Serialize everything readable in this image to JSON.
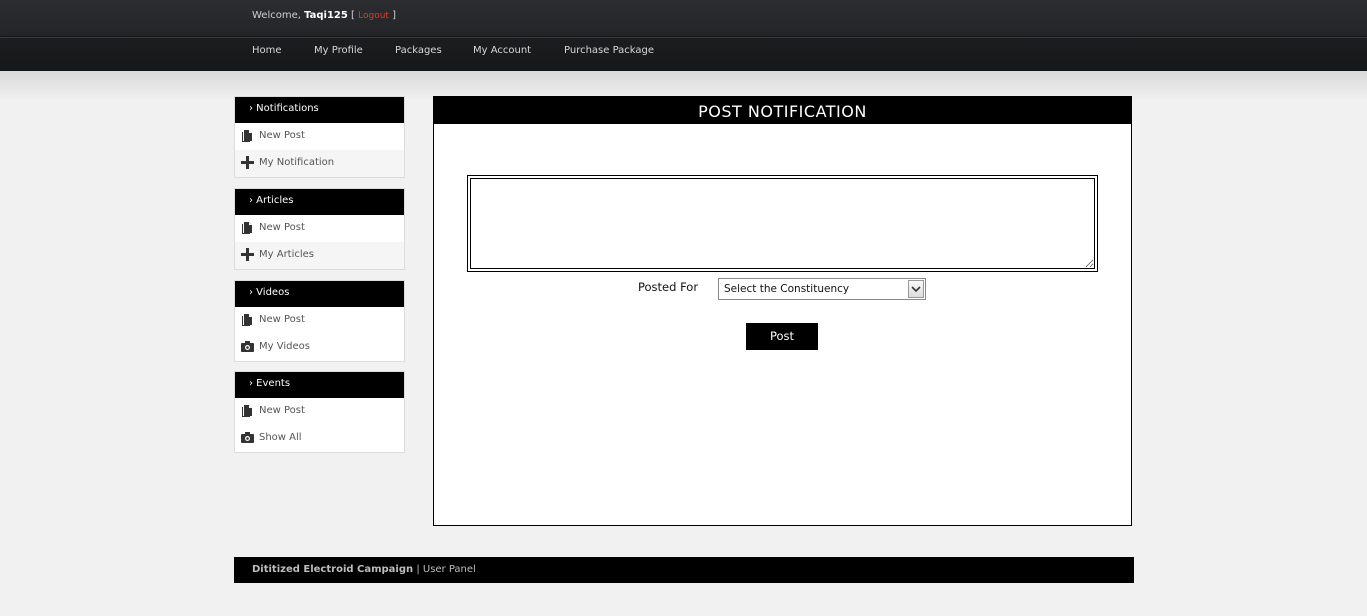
{
  "header": {
    "welcome_prefix": "Welcome,",
    "username": "Taqi125",
    "logout_label": "Logout"
  },
  "nav": [
    {
      "label": "Home"
    },
    {
      "label": "My Profile"
    },
    {
      "label": "Packages"
    },
    {
      "label": "My Account"
    },
    {
      "label": "Purchase Package"
    }
  ],
  "sidebar": [
    {
      "title": "› Notifications",
      "items": [
        {
          "label": "New Post",
          "icon": "document-icon"
        },
        {
          "label": "My Notification",
          "icon": "plus-icon"
        }
      ]
    },
    {
      "title": "› Articles",
      "items": [
        {
          "label": "New Post",
          "icon": "document-icon"
        },
        {
          "label": "My Articles",
          "icon": "plus-icon"
        }
      ]
    },
    {
      "title": "› Videos",
      "items": [
        {
          "label": "New Post",
          "icon": "document-icon"
        },
        {
          "label": "My Videos",
          "icon": "camera-icon"
        }
      ]
    },
    {
      "title": "› Events",
      "items": [
        {
          "label": "New Post",
          "icon": "document-icon"
        },
        {
          "label": "Show All",
          "icon": "camera-icon"
        }
      ]
    }
  ],
  "main": {
    "title": "POST NOTIFICATION",
    "message_value": "",
    "posted_for_label": "Posted For",
    "constituency_select": "Select the Constituency",
    "post_button": "Post"
  },
  "footer": {
    "brand": "Dititized Electroid Campaign",
    "separator": "|",
    "section": "User Panel"
  },
  "colors": {
    "topbar": "#2a2b2e",
    "accent_black": "#000000",
    "logout_red": "#e23a22",
    "background": "#f1f1f1"
  }
}
